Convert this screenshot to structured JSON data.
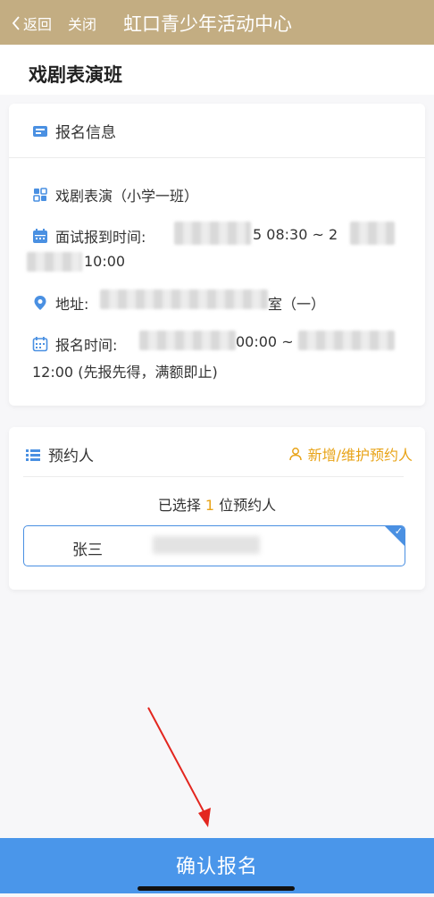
{
  "nav": {
    "back_label": "返回",
    "close_label": "关闭",
    "title": "虹口青少年活动中心"
  },
  "page": {
    "title": "戏剧表演班"
  },
  "signup_info": {
    "section_title": "报名信息",
    "course_name": "戏剧表演（小学一班）",
    "interview_label": "面试报到时间:",
    "interview_time_part1": "5 08:30 ~ 2",
    "interview_time_part2": "10:00",
    "address_label": "地址:",
    "address_tail": "室（一）",
    "register_label": "报名时间:",
    "register_time_part1": "00:00 ~",
    "register_time_part2": "12:00 (先报先得，满额即止)"
  },
  "booker": {
    "section_title": "预约人",
    "manage_label": "新增/维护预约人",
    "selected_prefix": "已选择 ",
    "selected_count": "1",
    "selected_suffix": " 位预约人",
    "person_name": "张三"
  },
  "footer": {
    "confirm_label": "确认报名"
  },
  "colors": {
    "header_bg": "#c3ad82",
    "accent_orange": "#e8a317",
    "accent_blue": "#4a96ea",
    "arrow_red": "#e3261f"
  },
  "icons": {
    "back": "chevron-left-icon",
    "section1": "id-card-icon",
    "course": "grid-icon",
    "interview": "calendar-icon",
    "address": "location-pin-icon",
    "register": "calendar-icon",
    "section2": "list-icon",
    "manage": "person-icon"
  }
}
